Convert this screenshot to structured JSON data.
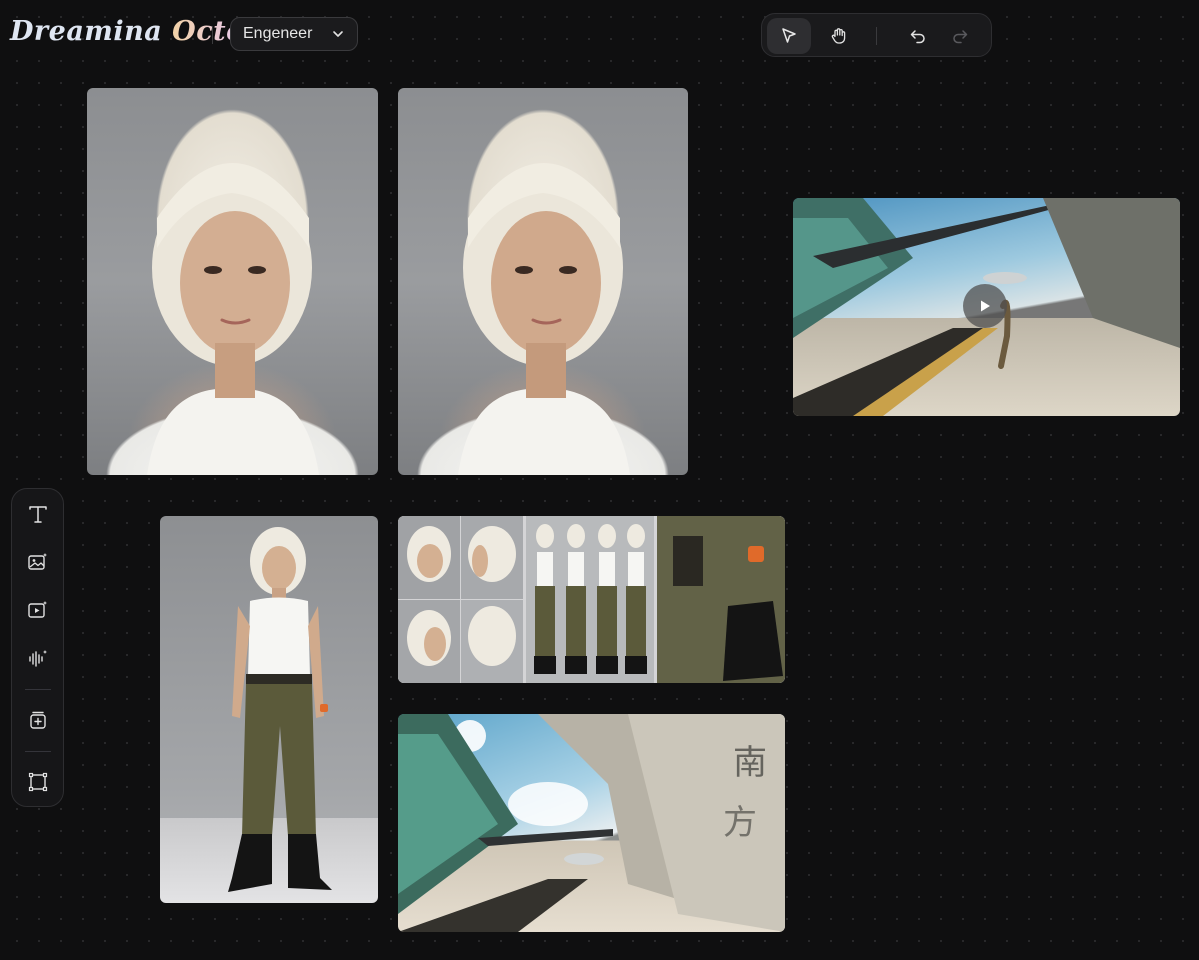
{
  "app": {
    "logo_text_main": "Dreamina ",
    "logo_text_accent": "Octo"
  },
  "header": {
    "project_select": {
      "value": "Engeneer",
      "icon": "chevron-down-icon"
    }
  },
  "toolbar": {
    "tools": [
      {
        "name": "select-tool",
        "icon": "cursor-arrow-icon",
        "active": true
      },
      {
        "name": "pan-tool",
        "icon": "hand-icon",
        "active": false
      },
      {
        "name": "undo",
        "icon": "undo-icon",
        "enabled": true
      },
      {
        "name": "redo",
        "icon": "redo-icon",
        "enabled": false
      }
    ]
  },
  "rail": {
    "tools": [
      {
        "name": "text-tool",
        "icon": "text-icon"
      },
      {
        "name": "image-generate-tool",
        "icon": "image-sparkle-icon"
      },
      {
        "name": "video-generate-tool",
        "icon": "video-sparkle-icon"
      },
      {
        "name": "audio-generate-tool",
        "icon": "audio-wave-sparkle-icon"
      },
      {
        "name": "add-asset-tool",
        "icon": "stack-plus-icon"
      },
      {
        "name": "frame-tool",
        "icon": "frame-icon"
      }
    ]
  },
  "canvas": {
    "items": [
      {
        "kind": "image",
        "subject": "portrait-blonde-bob-white-tank"
      },
      {
        "kind": "image",
        "subject": "portrait-blonde-bob-white-tank-variant"
      },
      {
        "kind": "video",
        "subject": "station-walkway-runner",
        "icon": "play-icon"
      },
      {
        "kind": "image",
        "subject": "full-body-cargo-pants-boots"
      },
      {
        "kind": "image",
        "subject": "character-reference-sheet"
      },
      {
        "kind": "image",
        "subject": "futuristic-station-corridor"
      }
    ]
  },
  "colors": {
    "background": "#0f0f10",
    "panel": "#1a1a1c",
    "border": "#2e2e31",
    "icon": "#e2e2e2",
    "icon_disabled": "#5a5a5e"
  }
}
